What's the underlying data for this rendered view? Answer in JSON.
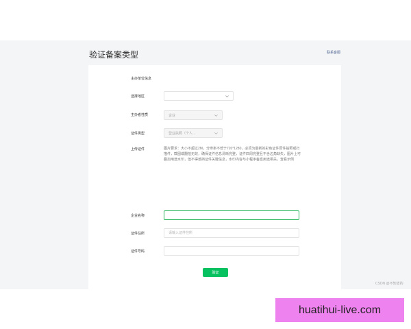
{
  "header": {
    "title": "验证备案类型",
    "contact_link": "联系客服"
  },
  "form": {
    "section_title": "主办单位信息",
    "region": {
      "label": "选择地区",
      "value": ""
    },
    "nature": {
      "label": "主办者性质",
      "value": "企业"
    },
    "cert_type": {
      "label": "证件类型",
      "value": "营业执照（个人..."
    },
    "upload": {
      "label": "上传证件",
      "note": "图片要求：大小不超过2M，分辨率不低于720*1280，必须为最新的彩色证件原件拍照或扫描件，截图或翻拍无效，确保证件信息清晰完整，证件四周完整且不含边角缺失，图片上可叠加用途水印，但不得遮挡证件关键信息，水印内容与小程序备案用途相关，查看示例"
    },
    "company_name": {
      "label": "企业名称",
      "value": ""
    },
    "address": {
      "label": "证件住所",
      "placeholder": "请输入证件住所"
    },
    "number": {
      "label": "证件号码",
      "value": ""
    },
    "submit_label": "验证"
  },
  "footer": {
    "watermark": "CSDN @不知道的",
    "site_banner": "huatihui-live.com"
  },
  "colors": {
    "accent": "#07c160",
    "focus_border": "#2bb65c",
    "link": "#576b95",
    "banner": "#ee82ee",
    "page_bg": "#f4f5f7"
  }
}
